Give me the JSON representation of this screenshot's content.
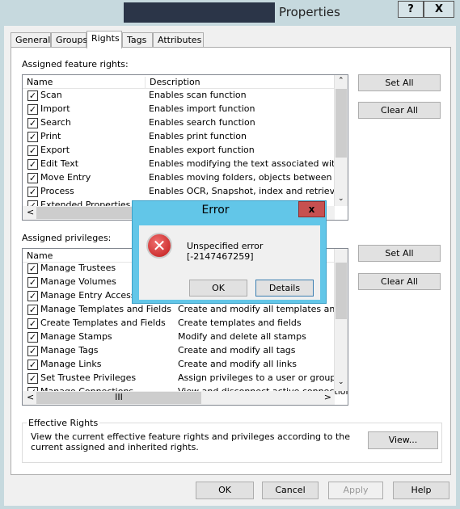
{
  "window": {
    "title": "Properties",
    "help": "?",
    "close": "X"
  },
  "tabs": [
    {
      "label": "General"
    },
    {
      "label": "Groups"
    },
    {
      "label": "Rights"
    },
    {
      "label": "Tags"
    },
    {
      "label": "Attributes"
    }
  ],
  "features": {
    "label": "Assigned feature rights:",
    "col_name": "Name",
    "col_desc": "Description",
    "set_all": "Set All",
    "clear_all": "Clear All",
    "rows": [
      {
        "name": "Scan",
        "desc": "Enables scan function"
      },
      {
        "name": "Import",
        "desc": "Enables import function"
      },
      {
        "name": "Search",
        "desc": "Enables search function"
      },
      {
        "name": "Print",
        "desc": "Enables print function"
      },
      {
        "name": "Export",
        "desc": "Enables export function"
      },
      {
        "name": "Edit Text",
        "desc": "Enables modifying the text associated with a do"
      },
      {
        "name": "Move Entry",
        "desc": "Enables moving folders, objects between folder"
      },
      {
        "name": "Process",
        "desc": "Enables OCR, Snapshot, index and retrieval of"
      },
      {
        "name": "Extended Properties",
        "desc": ""
      }
    ]
  },
  "privileges": {
    "label": "Assigned privileges:",
    "col_name": "Name",
    "set_all": "Set All",
    "clear_all": "Clear All",
    "rows": [
      {
        "name": "Manage Trustees",
        "desc": ""
      },
      {
        "name": "Manage Volumes",
        "desc": ""
      },
      {
        "name": "Manage Entry Access",
        "desc": ""
      },
      {
        "name": "Manage Templates and Fields",
        "desc": "Create and modify all templates and fiel"
      },
      {
        "name": "Create Templates and Fields",
        "desc": "Create templates and fields"
      },
      {
        "name": "Manage Stamps",
        "desc": "Modify and delete all stamps"
      },
      {
        "name": "Manage Tags",
        "desc": "Create and modify all tags"
      },
      {
        "name": "Manage Links",
        "desc": "Create and modify all links"
      },
      {
        "name": "Set Trustee Privileges",
        "desc": "Assign privileges to a user or group"
      },
      {
        "name": "Manage Connections",
        "desc": "View and disconnect active connections"
      }
    ]
  },
  "effective": {
    "title": "Effective Rights",
    "text": "View the current effective feature rights and privileges according to the current assigned and inherited rights.",
    "view": "View..."
  },
  "footer": {
    "ok": "OK",
    "cancel": "Cancel",
    "apply": "Apply",
    "help": "Help"
  },
  "error": {
    "title": "Error",
    "message": "Unspecified error [-2147467259]",
    "ok": "OK",
    "details": "Details",
    "close": "x"
  }
}
